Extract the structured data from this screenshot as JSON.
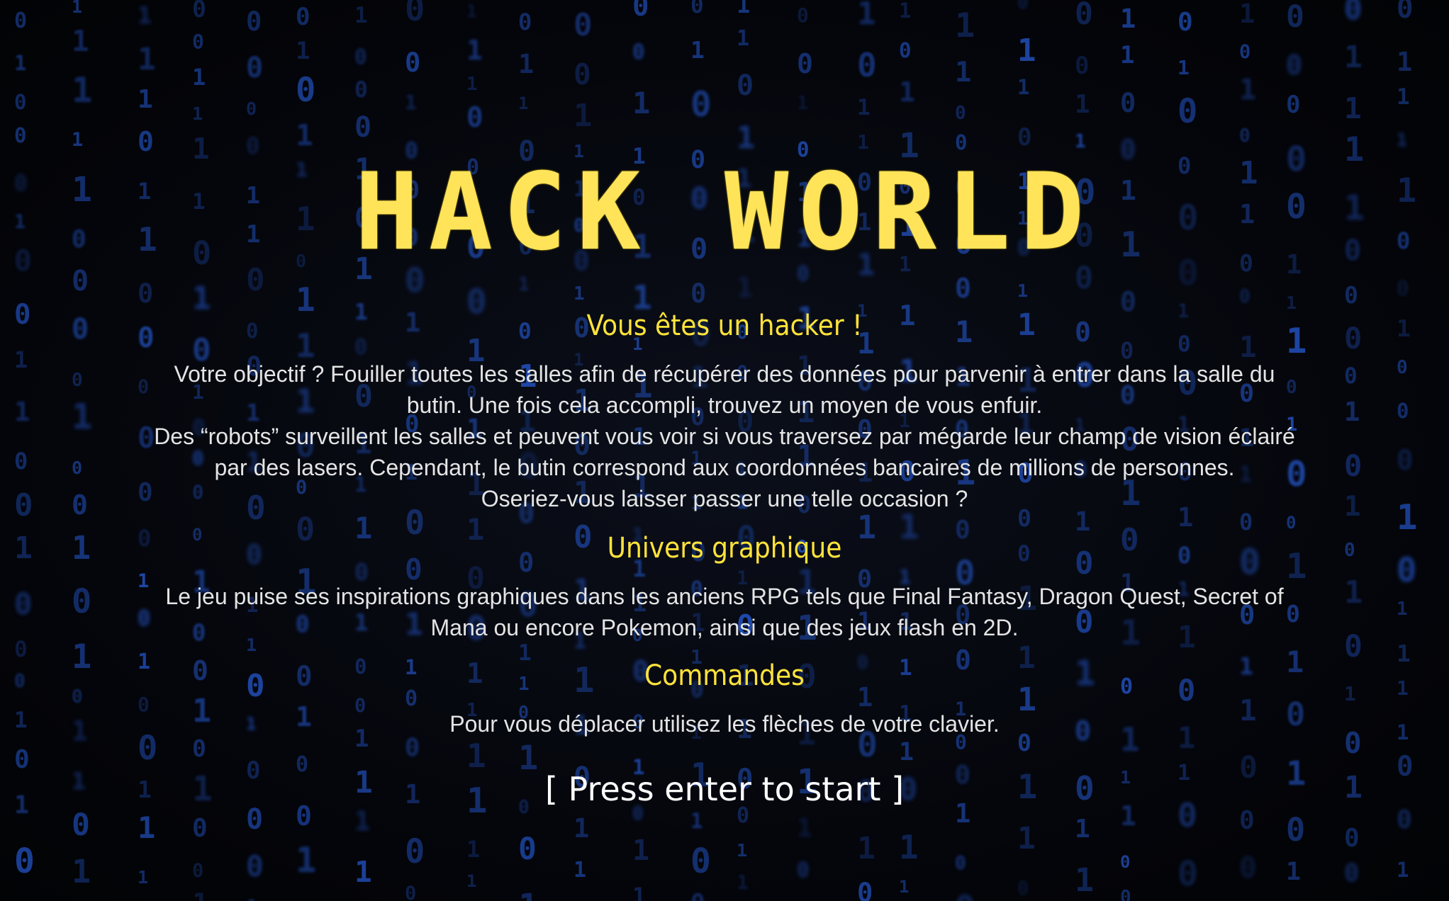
{
  "title": "HACK WORLD",
  "sections": {
    "intro": {
      "heading": "Vous êtes un hacker !",
      "line1": "Votre objectif ? Fouiller toutes les salles afin de récupérer des données pour parvenir à entrer dans la salle du",
      "line2": "butin. Une fois cela accompli, trouvez un moyen de vous enfuir.",
      "line3": "Des “robots” surveillent les salles et peuvent vous voir si vous traversez par mégarde leur champ de vision éclairé",
      "line4": "par des lasers. Cependant, le butin correspond aux coordonnées bancaires de millions de personnes.",
      "line5": "Oseriez-vous laisser passer une telle occasion ?"
    },
    "graphics": {
      "heading": "Univers graphique",
      "line1": "Le jeu puise ses inspirations graphiques dans les anciens RPG tels que Final Fantasy, Dragon Quest, Secret of",
      "line2": "Mana ou encore Pokemon, ainsi que des jeux flash en 2D."
    },
    "controls": {
      "heading": "Commandes",
      "line1": "Pour vous déplacer utilisez les flèches de votre clavier."
    }
  },
  "start_prompt": "[ Press enter to start ]",
  "colors": {
    "title": "#ffe45a",
    "heading": "#ffe33a",
    "body_text": "#e4e4e4",
    "prompt": "#ffffff",
    "background": "#050608",
    "rain": "#1f3f8f"
  },
  "background_glyphs": [
    "0",
    "1"
  ]
}
